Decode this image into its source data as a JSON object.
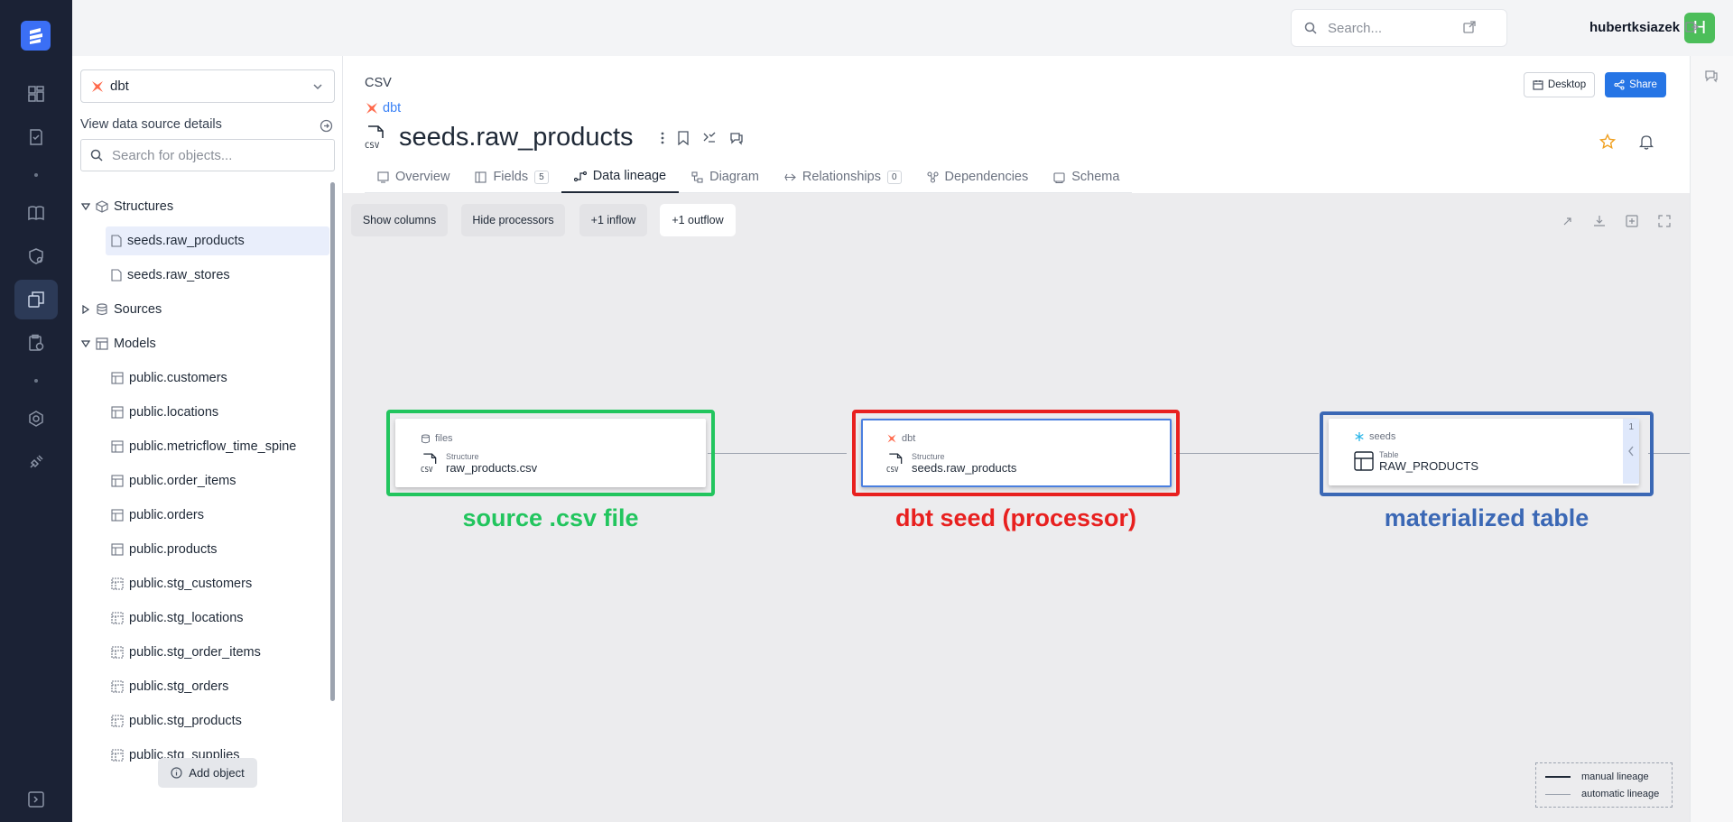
{
  "topbar": {
    "search_placeholder": "Search...",
    "username": "hubertksiazek",
    "avatar_letter": "H"
  },
  "sidebar": {
    "data_source": "dbt",
    "view_details": "View data source details",
    "search_placeholder": "Search for objects...",
    "tree": {
      "structures": "Structures",
      "structures_items": [
        "seeds.raw_products",
        "seeds.raw_stores"
      ],
      "sources": "Sources",
      "models": "Models",
      "models_items": [
        "public.customers",
        "public.locations",
        "public.metricflow_time_spine",
        "public.order_items",
        "public.orders",
        "public.products",
        "public.stg_customers",
        "public.stg_locations",
        "public.stg_order_items",
        "public.stg_orders",
        "public.stg_products",
        "public.stg_supplies"
      ]
    },
    "add_object": "Add object"
  },
  "header": {
    "crumb_type": "CSV",
    "crumb_source": "dbt",
    "title": "seeds.raw_products",
    "desktop": "Desktop",
    "share": "Share",
    "tabs": [
      {
        "label": "Overview"
      },
      {
        "label": "Fields",
        "badge": "5"
      },
      {
        "label": "Data lineage"
      },
      {
        "label": "Diagram"
      },
      {
        "label": "Relationships",
        "badge": "0"
      },
      {
        "label": "Dependencies"
      },
      {
        "label": "Schema"
      }
    ]
  },
  "lineage": {
    "toolbar": [
      "Show columns",
      "Hide processors",
      "+1 inflow",
      "+1 outflow"
    ],
    "nodes": [
      {
        "source": "files",
        "kind": "Structure",
        "name": "raw_products.csv"
      },
      {
        "source": "dbt",
        "kind": "Structure",
        "name": "seeds.raw_products"
      },
      {
        "source": "seeds",
        "kind": "Table",
        "name": "RAW_PRODUCTS",
        "count": "1"
      }
    ],
    "annotations": [
      {
        "text": "source .csv file",
        "color": "#22c55e"
      },
      {
        "text": "dbt seed (processor)",
        "color": "#e8201f"
      },
      {
        "text": "materialized table",
        "color": "#3b68b5"
      }
    ],
    "legend": {
      "manual": "manual lineage",
      "automatic": "automatic lineage"
    }
  },
  "colors": {
    "rail": "#1b2235",
    "accent": "#2675e5",
    "avatar": "#4cbe5a",
    "dbt": "#ff694b"
  }
}
